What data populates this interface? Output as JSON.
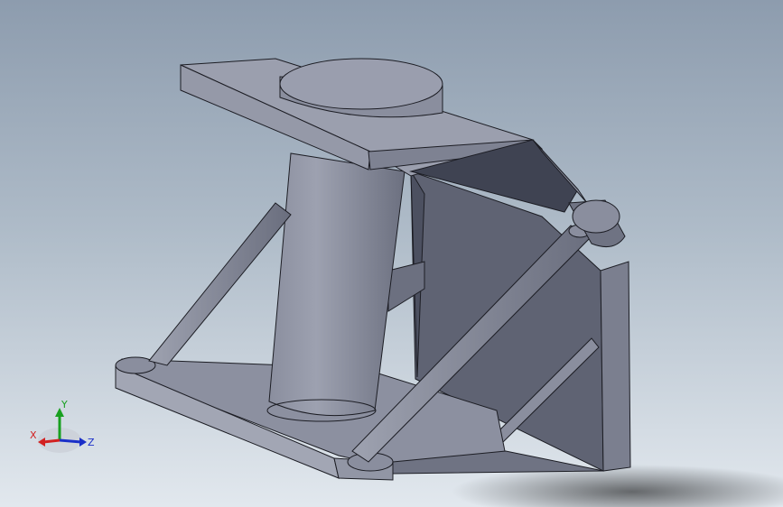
{
  "viewport": {
    "background_top": "#8d9cae",
    "background_bottom": "#e2e8ee"
  },
  "model": {
    "part_color": "#7c8192",
    "face_light": "#a2a6b4",
    "face_mid": "#8a8e9e",
    "face_dark": "#5e6272",
    "edge_color": "#1c1d24"
  },
  "triad": {
    "x_label": "X",
    "y_label": "Y",
    "z_label": "Z",
    "x_color": "#d22020",
    "y_color": "#18a020",
    "z_color": "#1a2fc8"
  }
}
